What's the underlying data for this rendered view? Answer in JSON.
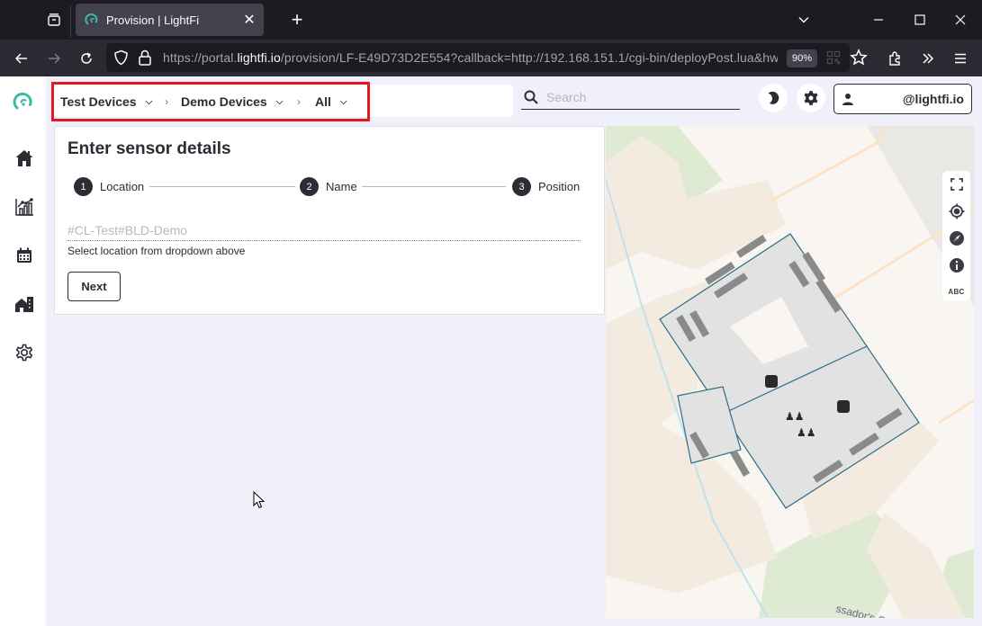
{
  "browser": {
    "tab": {
      "title": "Provision | LightFi",
      "favicon": "lightfi-logo-icon"
    },
    "url": {
      "prefix": "https://portal.",
      "domain": "lightfi.io",
      "rest": "/provision/LF-E49D73D2E554?callback=http://192.168.151.1/cgi-bin/deployPost.lua&hwV"
    },
    "zoom_level": "90%",
    "icons": [
      "tab-list-icon",
      "new-tab-icon",
      "list-all-tabs-icon",
      "minimize-icon",
      "maximize-icon",
      "close-window-icon",
      "back-icon",
      "forward-icon",
      "reload-icon",
      "shield-icon",
      "lock-icon",
      "qr-code-icon",
      "bookmark-star-icon",
      "extensions-icon",
      "overflow-icon",
      "menu-icon"
    ]
  },
  "sidebar": {
    "items": [
      {
        "name": "home",
        "icon": "home-icon"
      },
      {
        "name": "analytics",
        "icon": "chart-icon"
      },
      {
        "name": "calendar",
        "icon": "calendar-icon"
      },
      {
        "name": "buildings",
        "icon": "building-icon"
      },
      {
        "name": "settings",
        "icon": "gear-icon"
      }
    ]
  },
  "header": {
    "breadcrumb": [
      {
        "label": "Test Devices"
      },
      {
        "label": "Demo Devices"
      },
      {
        "label": "All"
      }
    ],
    "search": {
      "placeholder": "Search",
      "value": ""
    },
    "user": {
      "email": "@lightfi.io"
    }
  },
  "form": {
    "title": "Enter sensor details",
    "steps": [
      {
        "number": "1",
        "label": "Location"
      },
      {
        "number": "2",
        "name": "Name",
        "label": "Name"
      },
      {
        "number": "3",
        "label": "Position"
      }
    ],
    "location_input": {
      "placeholder": "#CL-Test#BLD-Demo",
      "value": ""
    },
    "helper_text": "Select location from dropdown above",
    "next_label": "Next"
  },
  "map": {
    "street_label": "ssador's C",
    "controls": [
      {
        "name": "fullscreen",
        "icon": "fullscreen-icon"
      },
      {
        "name": "locate",
        "icon": "crosshair-icon"
      },
      {
        "name": "compass",
        "icon": "compass-icon"
      },
      {
        "name": "info",
        "icon": "info-icon"
      },
      {
        "name": "labels",
        "label": "ABC"
      }
    ]
  },
  "colors": {
    "brand_teal": "#3fb8a4",
    "highlight_red": "#e8161f",
    "text_dark": "#2a2d34",
    "app_bg": "#f0f0fa"
  }
}
